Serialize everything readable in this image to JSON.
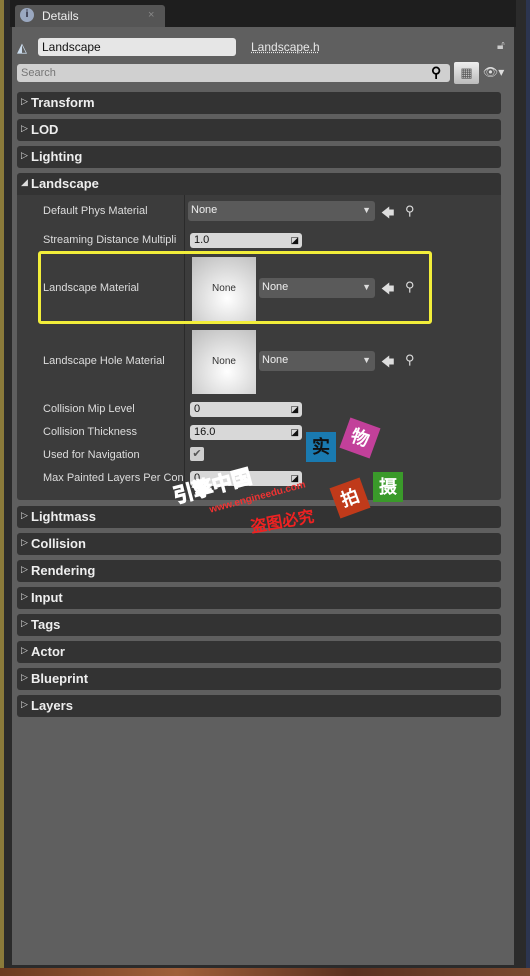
{
  "tab": {
    "title": "Details",
    "icon": "info-icon",
    "close": "×"
  },
  "header": {
    "name_value": "Landscape",
    "header_link": "Landscape.h",
    "search_placeholder": "Search"
  },
  "categories_top": [
    {
      "label": "Transform",
      "expanded": false
    },
    {
      "label": "LOD",
      "expanded": false
    },
    {
      "label": "Lighting",
      "expanded": false
    },
    {
      "label": "Landscape",
      "expanded": true
    }
  ],
  "landscape": {
    "default_phys_material": {
      "label": "Default Phys Material",
      "value": "None"
    },
    "streaming_distance": {
      "label": "Streaming Distance Multipli",
      "value": "1.0"
    },
    "landscape_material": {
      "label": "Landscape Material",
      "thumb": "None",
      "value": "None"
    },
    "hole_material": {
      "label": "Landscape Hole Material",
      "thumb": "None",
      "value": "None"
    },
    "collision_mip": {
      "label": "Collision Mip Level",
      "value": "0"
    },
    "collision_thickness": {
      "label": "Collision Thickness",
      "value": "16.0"
    },
    "used_for_navigation": {
      "label": "Used for Navigation",
      "checked": true
    },
    "max_painted_layers": {
      "label": "Max Painted Layers Per Con",
      "value": "0"
    }
  },
  "categories_bottom": [
    {
      "label": "Lightmass"
    },
    {
      "label": "Collision"
    },
    {
      "label": "Rendering"
    },
    {
      "label": "Input"
    },
    {
      "label": "Tags"
    },
    {
      "label": "Actor"
    },
    {
      "label": "Blueprint"
    },
    {
      "label": "Layers"
    }
  ],
  "highlight_color": "#f2ee3a",
  "watermark": {
    "brand": "引擎中国",
    "url": "www.engineedu.com",
    "notice": "盗图必究",
    "chars": [
      "实",
      "物",
      "拍",
      "摄"
    ]
  }
}
